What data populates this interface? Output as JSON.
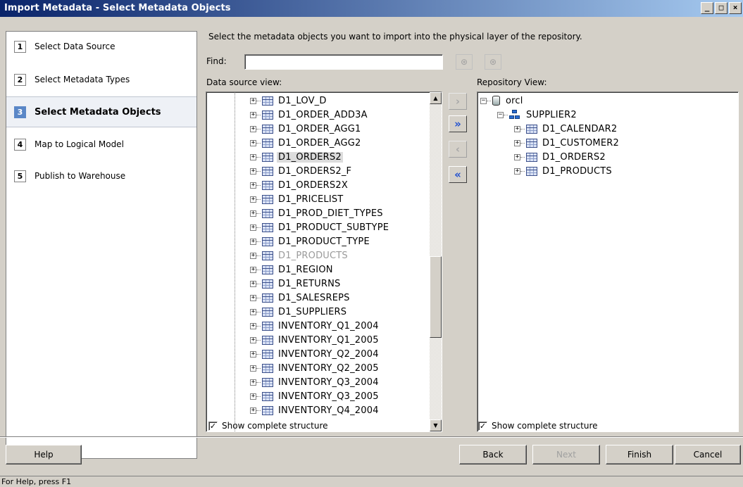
{
  "window": {
    "title": "Import Metadata - Select Metadata Objects",
    "controls": [
      "_",
      "□",
      "×"
    ]
  },
  "wizard": {
    "steps": [
      {
        "num": "1",
        "label": "Select Data Source"
      },
      {
        "num": "2",
        "label": "Select Metadata Types"
      },
      {
        "num": "3",
        "label": "Select Metadata Objects"
      },
      {
        "num": "4",
        "label": "Map to Logical Model"
      },
      {
        "num": "5",
        "label": "Publish to Warehouse"
      }
    ],
    "active_step": 3
  },
  "main": {
    "instruction": "Select the metadata objects you want to import into the physical layer of the repository.",
    "find_label": "Find:",
    "find_value": "",
    "datasource_label": "Data source view:",
    "repository_label": "Repository View:",
    "datasource_items": [
      "D1_LOV_D",
      "D1_ORDER_ADD3A",
      "D1_ORDER_AGG1",
      "D1_ORDER_AGG2",
      "D1_ORDERS2",
      "D1_ORDERS2_F",
      "D1_ORDERS2X",
      "D1_PRICELIST",
      "D1_PROD_DIET_TYPES",
      "D1_PRODUCT_SUBTYPE",
      "D1_PRODUCT_TYPE",
      "D1_PRODUCTS",
      "D1_REGION",
      "D1_RETURNS",
      "D1_SALESREPS",
      "D1_SUPPLIERS",
      "INVENTORY_Q1_2004",
      "INVENTORY_Q1_2005",
      "INVENTORY_Q2_2004",
      "INVENTORY_Q2_2005",
      "INVENTORY_Q3_2004",
      "INVENTORY_Q3_2005",
      "INVENTORY_Q4_2004"
    ],
    "selected_item": "D1_ORDERS2",
    "dimmed_item": "D1_PRODUCTS",
    "repository_tree": {
      "root": "orcl",
      "schema": "SUPPLIER2",
      "tables": [
        "D1_CALENDAR2",
        "D1_CUSTOMER2",
        "D1_ORDERS2",
        "D1_PRODUCTS"
      ]
    },
    "show_structure_label": "Show complete structure",
    "show_structure_left": true,
    "show_structure_right": true
  },
  "buttons": {
    "help": "Help",
    "back": "Back",
    "next": "Next",
    "finish": "Finish",
    "cancel": "Cancel"
  },
  "status": "For Help, press F1",
  "colors": {
    "title_start": "#0a246a",
    "title_end": "#a6caf0",
    "active_step": "#5a87c7",
    "mover_arrow": "#1f4fd0"
  }
}
